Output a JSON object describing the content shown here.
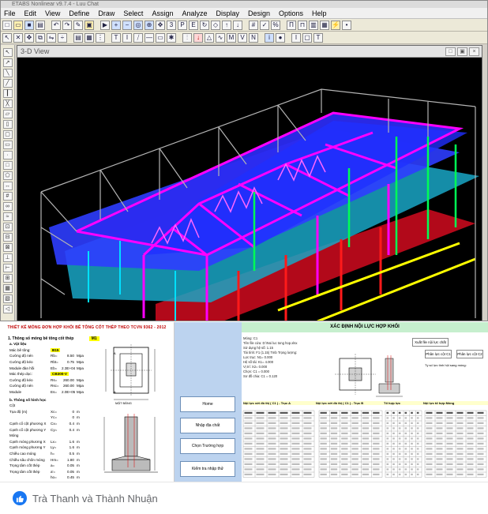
{
  "etabs": {
    "title": "ETABS Nonlinear v9.7.4 - Luu Chat",
    "menu": [
      "File",
      "Edit",
      "View",
      "Define",
      "Draw",
      "Select",
      "Assign",
      "Analyze",
      "Display",
      "Design",
      "Options",
      "Help"
    ],
    "view_title": "3-D View",
    "view_buttons": [
      "□",
      "▣",
      "×"
    ]
  },
  "sheet1": {
    "title": "THIẾT KẾ MÓNG ĐƠN HỢP KHỐI BÊ TÔNG CỐT THÉP THEO TCVN 9362 - 2012",
    "section1_label": "1. Thông số móng bê tông cốt thép",
    "section1_code": "M1",
    "material_header": "a. Vật liệu",
    "rows1": [
      {
        "label": "Mác bê tông:",
        "hl": "B15",
        "sym": "",
        "val": "",
        "unit": ""
      },
      {
        "label": "Cường độ nén",
        "hl": "",
        "sym": "Rb=",
        "val": "8.50",
        "unit": "Mpa"
      },
      {
        "label": "Cường độ kéo",
        "hl": "",
        "sym": "Rbt=",
        "val": "0.75",
        "unit": "Mpa"
      },
      {
        "label": "Module đàn hồi",
        "hl": "",
        "sym": "Eb=",
        "val": "2.3E+04",
        "unit": "Mpa"
      },
      {
        "label": "Mác thép dọc:",
        "hl": "CB300-V",
        "sym": "",
        "val": "",
        "unit": ""
      },
      {
        "label": "Cường độ kéo",
        "hl": "",
        "sym": "Rs=",
        "val": "260.00",
        "unit": "Mpa"
      },
      {
        "label": "Cường độ nén",
        "hl": "",
        "sym": "Rsc=",
        "val": "260.00",
        "unit": "Mpa"
      },
      {
        "label": "Module",
        "hl": "",
        "sym": "Es=",
        "val": "2.0E+05",
        "unit": "Mpa"
      }
    ],
    "section2_label": "b. Thông số hình học",
    "section2_sub": "Cột",
    "rows2": [
      {
        "label": "Tọa độ (m)",
        "sym": "Xc=",
        "val": "0",
        "unit": "m"
      },
      {
        "label": "",
        "sym": "Yc=",
        "val": "0",
        "unit": "m"
      },
      {
        "label": "Cạnh cổ cột phương X",
        "sym": "Cx=",
        "val": "0.4",
        "unit": "m"
      },
      {
        "label": "Cạnh cổ cột phương Y",
        "sym": "Cy=",
        "val": "0.4",
        "unit": "m"
      },
      {
        "label": "Móng",
        "sym": "",
        "val": "",
        "unit": ""
      },
      {
        "label": "Cạnh móng phương X",
        "sym": "Lx=",
        "val": "1.6",
        "unit": "m"
      },
      {
        "label": "Cạnh móng phương Y",
        "sym": "Ly=",
        "val": "1.6",
        "unit": "m"
      },
      {
        "label": "Chiều cao móng",
        "sym": "h=",
        "val": "0.5",
        "unit": "m"
      },
      {
        "label": "Chiều sâu chôn móng",
        "sym": "Hm=",
        "val": "1.80",
        "unit": "m"
      },
      {
        "label": "Trọng tâm cốt thép",
        "sym": "a=",
        "val": "0.05",
        "unit": "m"
      },
      {
        "label": "Trọng tâm cốt thép",
        "sym": "a'=",
        "val": "0.05",
        "unit": "m"
      },
      {
        "label": "",
        "sym": "ho=",
        "val": "0.45",
        "unit": "m"
      }
    ],
    "plan_label": "MẶT BẰNG",
    "dim_labels": [
      "A",
      "A"
    ]
  },
  "panel": {
    "buttons": [
      "Home",
      "Nhập địa chất",
      "Chọn Trường hợp",
      "Kiểm tra nhập thử"
    ]
  },
  "sheet2": {
    "title": "XÁC ĐỊNH NỘI LỰC HỢP KHỐI",
    "buttons": [
      "Xuất file nội lực chất",
      "Phân lực cột C1",
      "Phân lực cột C2"
    ],
    "lines": [
      "Móng:        C1",
      "Tên file cửa: D:\\Noi luc tong hop.xlsx",
      "Sử dụng hệ số:  1.15",
      "Tải tính:  F1 (1.15)  Tmb   Trọng lượng:",
      "Lực trục:  N1=   0.000",
      "Hệ số tải:  K1=   4.000",
      "Vị trí:  X2=   0.000",
      "Chọn:  C1 =   0.000",
      "Sơ đồ chia:  C1 =   0.120"
    ],
    "side_text": "Tỷ số lực tính hội sang móng:",
    "table_headers": [
      "Nội lực với đồ thị ( C1 ) - Trục A",
      "Nội lực với đồ thị ( C1 ) - Trục B",
      "Tổ hợp lực",
      "Nội lực tổ hợp Móng"
    ]
  },
  "footer": {
    "names": "Trà Thanh và Thành Nhuận"
  },
  "colors": {
    "magenta": "#ff00ff",
    "blue": "#1a3cff",
    "cyan": "#00d8ff",
    "red": "#ff0000",
    "green": "#00ff55",
    "yellow": "#ffff00",
    "facebook": "#1877f2"
  }
}
